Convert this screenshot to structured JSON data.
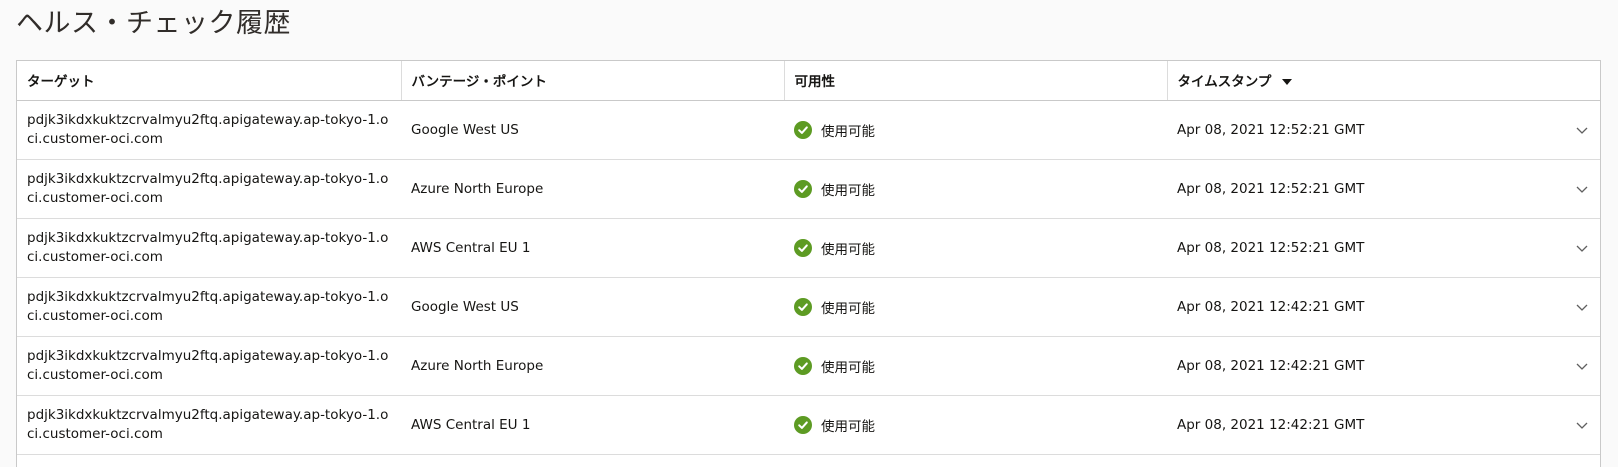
{
  "page": {
    "title": "ヘルス・チェック履歴"
  },
  "table": {
    "columns": {
      "target": "ターゲット",
      "vantage": "バンテージ・ポイント",
      "availability": "可用性",
      "timestamp": "タイムスタンプ"
    },
    "sort": {
      "column": "timestamp",
      "direction": "descending",
      "icon": "caret-down-icon"
    },
    "rows": [
      {
        "target": "pdjk3ikdxkuktzcrvalmyu2ftq.apigateway.ap-tokyo-1.oci.customer-oci.com",
        "vantage": "Google West US",
        "status": "使用可能",
        "timestamp": "Apr 08, 2021 12:52:21 GMT"
      },
      {
        "target": "pdjk3ikdxkuktzcrvalmyu2ftq.apigateway.ap-tokyo-1.oci.customer-oci.com",
        "vantage": "Azure North Europe",
        "status": "使用可能",
        "timestamp": "Apr 08, 2021 12:52:21 GMT"
      },
      {
        "target": "pdjk3ikdxkuktzcrvalmyu2ftq.apigateway.ap-tokyo-1.oci.customer-oci.com",
        "vantage": "AWS Central EU 1",
        "status": "使用可能",
        "timestamp": "Apr 08, 2021 12:52:21 GMT"
      },
      {
        "target": "pdjk3ikdxkuktzcrvalmyu2ftq.apigateway.ap-tokyo-1.oci.customer-oci.com",
        "vantage": "Google West US",
        "status": "使用可能",
        "timestamp": "Apr 08, 2021 12:42:21 GMT"
      },
      {
        "target": "pdjk3ikdxkuktzcrvalmyu2ftq.apigateway.ap-tokyo-1.oci.customer-oci.com",
        "vantage": "Azure North Europe",
        "status": "使用可能",
        "timestamp": "Apr 08, 2021 12:42:21 GMT"
      },
      {
        "target": "pdjk3ikdxkuktzcrvalmyu2ftq.apigateway.ap-tokyo-1.oci.customer-oci.com",
        "vantage": "AWS Central EU 1",
        "status": "使用可能",
        "timestamp": "Apr 08, 2021 12:42:21 GMT"
      }
    ]
  },
  "colors": {
    "status_ok": "#5d9b23",
    "border": "#c9c9c9",
    "text": "#161513"
  },
  "icons": {
    "status": "check-circle-icon",
    "row_expand": "chevron-down-icon"
  }
}
